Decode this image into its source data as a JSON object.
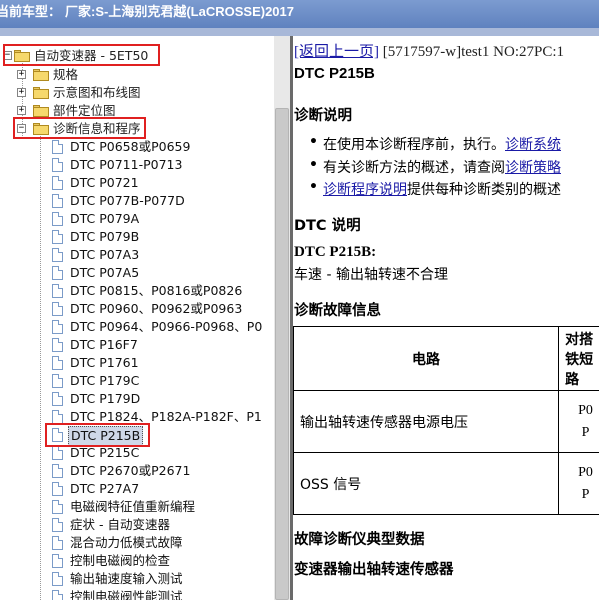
{
  "title_bar": {
    "label": "当前车型：",
    "value": "厂家:S-上海别克君越(LaCROSSE)2017"
  },
  "tree": {
    "root": {
      "label": "自动变速器 - 5ET50"
    },
    "folders": [
      {
        "label": "规格"
      },
      {
        "label": "示意图和布线图"
      },
      {
        "label": "部件定位图"
      },
      {
        "label": "诊断信息和程序"
      }
    ],
    "items": [
      "DTC P0658或P0659",
      "DTC P0711-P0713",
      "DTC P0721",
      "DTC P077B-P077D",
      "DTC P079A",
      "DTC P079B",
      "DTC P07A3",
      "DTC P07A5",
      "DTC P0815、P0816或P0826",
      "DTC P0960、P0962或P0963",
      "DTC P0964、P0966-P0968、P0",
      "DTC P16F7",
      "DTC P1761",
      "DTC P179C",
      "DTC P179D",
      "DTC P1824、P182A-P182F、P1",
      "DTC P215B",
      "DTC P215C",
      "DTC P2670或P2671",
      "DTC P27A7",
      "电磁阀特征值重新编程",
      "症状 - 自动变速器",
      "混合动力低模式故障",
      "控制电磁阀的检查",
      "输出轴速度输入测试",
      "控制电磁阀性能测试"
    ],
    "selected_index": 16
  },
  "content": {
    "crumb_link": "[返回上一页]",
    "crumb_text": "[5717597-w]test1 NO:27PC:1",
    "dtc_title": "DTC P215B",
    "sec_diag_desc": "诊断说明",
    "bullets": [
      {
        "pre": "在使用本诊断程序前，执行。",
        "link": "诊断系统",
        "post": ""
      },
      {
        "pre": "有关诊断方法的概述，请查阅",
        "link": "诊断策略",
        "post": ""
      },
      {
        "pre": "",
        "link": "诊断程序说明",
        "post": "提供每种诊断类别的概述"
      }
    ],
    "sec_dtc_desc": "DTC 说明",
    "dtc_code_line": "DTC P215B:",
    "dtc_desc_line": "车速 - 输出轴转速不合理",
    "sec_fault_info": "诊断故障信息",
    "table": {
      "headers": [
        "电路",
        "对搭铁短路"
      ],
      "rows": [
        {
          "circuit": "输出轴转速传感器电源电压",
          "code1": "P0",
          "code2": "P"
        },
        {
          "circuit": "OSS 信号",
          "code1": "P0",
          "code2": "P"
        }
      ]
    },
    "sec_scan_data": "故障诊断仪典型数据",
    "sec_sensor": "变速器输出轴转速传感器"
  }
}
